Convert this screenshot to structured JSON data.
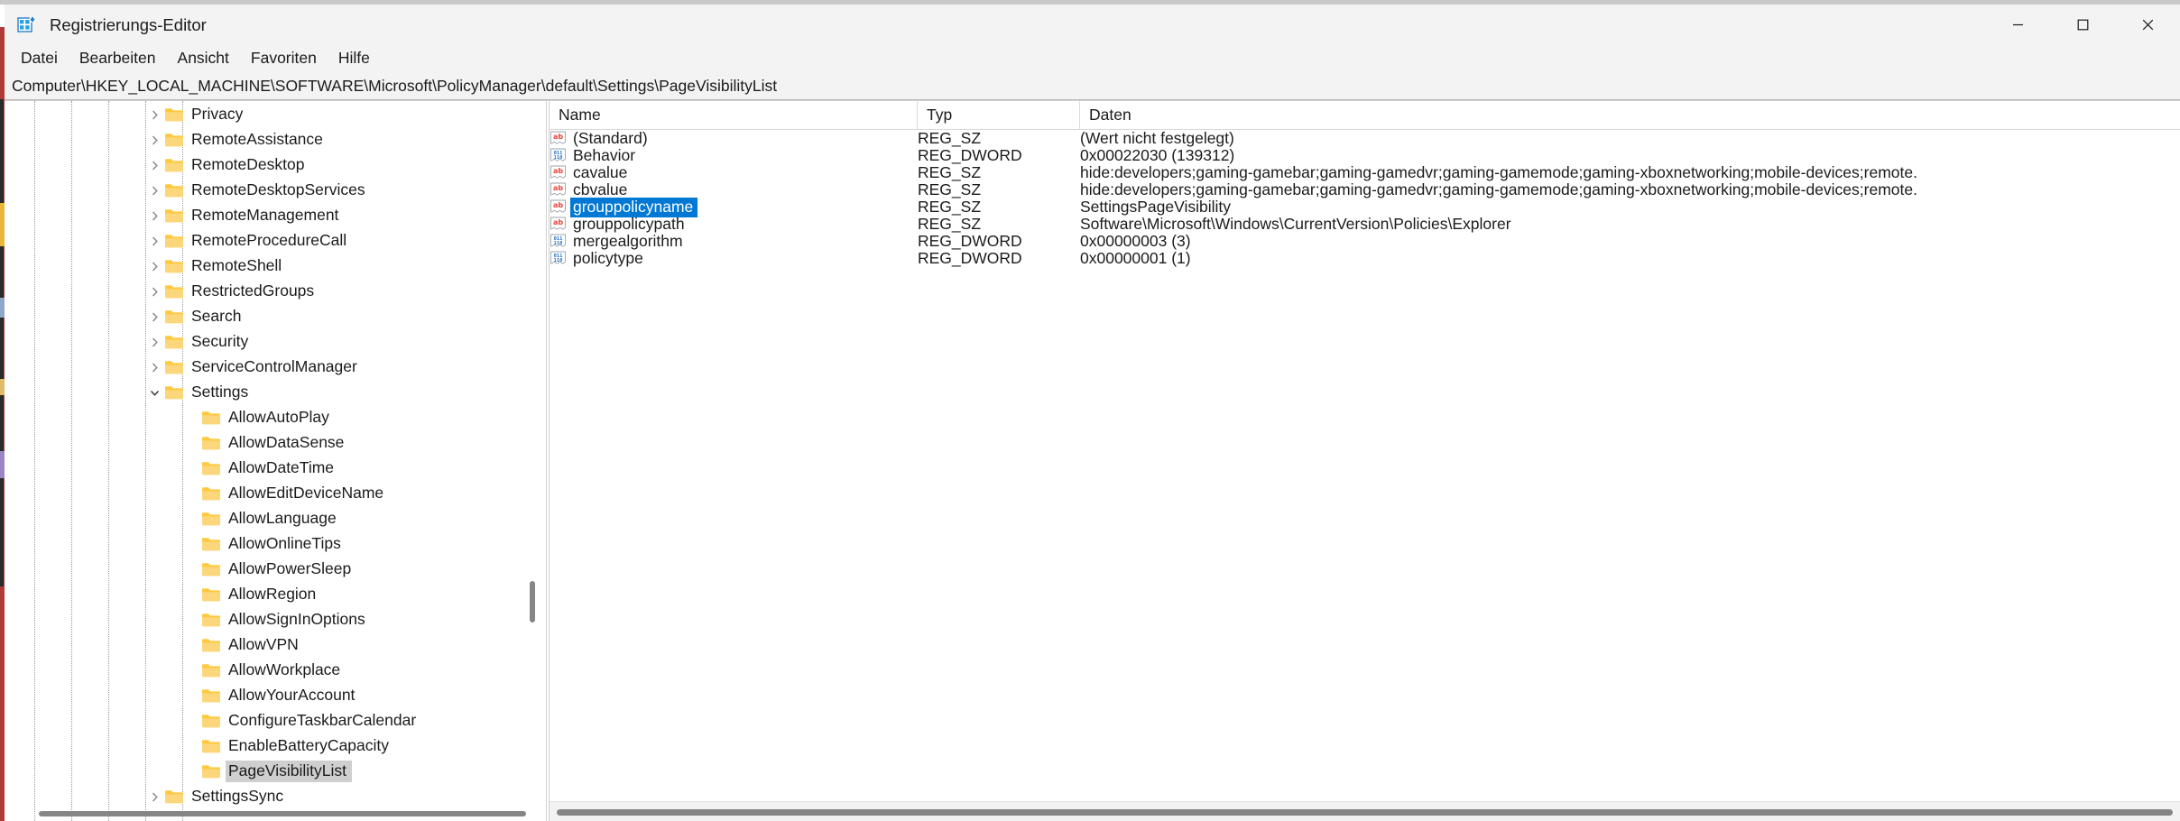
{
  "window": {
    "title": "Registrierungs-Editor",
    "icon": "registry-editor-icon",
    "controls": {
      "minimize": "minimize-icon",
      "maximize": "maximize-icon",
      "close": "close-icon"
    }
  },
  "menubar": {
    "items": [
      {
        "label": "Datei"
      },
      {
        "label": "Bearbeiten"
      },
      {
        "label": "Ansicht"
      },
      {
        "label": "Favoriten"
      },
      {
        "label": "Hilfe"
      }
    ]
  },
  "addressbar": {
    "path": "Computer\\HKEY_LOCAL_MACHINE\\SOFTWARE\\Microsoft\\PolicyManager\\default\\Settings\\PageVisibilityList"
  },
  "tree": {
    "items": [
      {
        "label": "Privacy",
        "depth": 5,
        "expander": "collapsed",
        "selected": false
      },
      {
        "label": "RemoteAssistance",
        "depth": 5,
        "expander": "collapsed",
        "selected": false
      },
      {
        "label": "RemoteDesktop",
        "depth": 5,
        "expander": "collapsed",
        "selected": false
      },
      {
        "label": "RemoteDesktopServices",
        "depth": 5,
        "expander": "collapsed",
        "selected": false
      },
      {
        "label": "RemoteManagement",
        "depth": 5,
        "expander": "collapsed",
        "selected": false
      },
      {
        "label": "RemoteProcedureCall",
        "depth": 5,
        "expander": "collapsed",
        "selected": false
      },
      {
        "label": "RemoteShell",
        "depth": 5,
        "expander": "collapsed",
        "selected": false
      },
      {
        "label": "RestrictedGroups",
        "depth": 5,
        "expander": "collapsed",
        "selected": false
      },
      {
        "label": "Search",
        "depth": 5,
        "expander": "collapsed",
        "selected": false
      },
      {
        "label": "Security",
        "depth": 5,
        "expander": "collapsed",
        "selected": false
      },
      {
        "label": "ServiceControlManager",
        "depth": 5,
        "expander": "collapsed",
        "selected": false
      },
      {
        "label": "Settings",
        "depth": 5,
        "expander": "expanded",
        "selected": false
      },
      {
        "label": "AllowAutoPlay",
        "depth": 6,
        "expander": "none",
        "selected": false
      },
      {
        "label": "AllowDataSense",
        "depth": 6,
        "expander": "none",
        "selected": false
      },
      {
        "label": "AllowDateTime",
        "depth": 6,
        "expander": "none",
        "selected": false
      },
      {
        "label": "AllowEditDeviceName",
        "depth": 6,
        "expander": "none",
        "selected": false
      },
      {
        "label": "AllowLanguage",
        "depth": 6,
        "expander": "none",
        "selected": false
      },
      {
        "label": "AllowOnlineTips",
        "depth": 6,
        "expander": "none",
        "selected": false
      },
      {
        "label": "AllowPowerSleep",
        "depth": 6,
        "expander": "none",
        "selected": false
      },
      {
        "label": "AllowRegion",
        "depth": 6,
        "expander": "none",
        "selected": false
      },
      {
        "label": "AllowSignInOptions",
        "depth": 6,
        "expander": "none",
        "selected": false
      },
      {
        "label": "AllowVPN",
        "depth": 6,
        "expander": "none",
        "selected": false
      },
      {
        "label": "AllowWorkplace",
        "depth": 6,
        "expander": "none",
        "selected": false
      },
      {
        "label": "AllowYourAccount",
        "depth": 6,
        "expander": "none",
        "selected": false
      },
      {
        "label": "ConfigureTaskbarCalendar",
        "depth": 6,
        "expander": "none",
        "selected": false
      },
      {
        "label": "EnableBatteryCapacity",
        "depth": 6,
        "expander": "none",
        "selected": false
      },
      {
        "label": "PageVisibilityList",
        "depth": 6,
        "expander": "none",
        "selected": true
      },
      {
        "label": "SettingsSync",
        "depth": 5,
        "expander": "collapsed",
        "selected": false
      }
    ]
  },
  "list": {
    "columns": [
      {
        "key": "name",
        "label": "Name"
      },
      {
        "key": "typ",
        "label": "Typ"
      },
      {
        "key": "daten",
        "label": "Daten"
      }
    ],
    "rows": [
      {
        "icon": "string-value-icon",
        "name": "(Standard)",
        "typ": "REG_SZ",
        "daten": "(Wert nicht festgelegt)",
        "selected": false
      },
      {
        "icon": "dword-value-icon",
        "name": "Behavior",
        "typ": "REG_DWORD",
        "daten": "0x00022030 (139312)",
        "selected": false
      },
      {
        "icon": "string-value-icon",
        "name": "cavalue",
        "typ": "REG_SZ",
        "daten": "hide:developers;gaming-gamebar;gaming-gamedvr;gaming-gamemode;gaming-xboxnetworking;mobile-devices;remote.",
        "selected": false
      },
      {
        "icon": "string-value-icon",
        "name": "cbvalue",
        "typ": "REG_SZ",
        "daten": "hide:developers;gaming-gamebar;gaming-gamedvr;gaming-gamemode;gaming-xboxnetworking;mobile-devices;remote.",
        "selected": false
      },
      {
        "icon": "string-value-icon",
        "name": "grouppolicyname",
        "typ": "REG_SZ",
        "daten": "SettingsPageVisibility",
        "selected": true
      },
      {
        "icon": "string-value-icon",
        "name": "grouppolicypath",
        "typ": "REG_SZ",
        "daten": "Software\\Microsoft\\Windows\\CurrentVersion\\Policies\\Explorer",
        "selected": false
      },
      {
        "icon": "dword-value-icon",
        "name": "mergealgorithm",
        "typ": "REG_DWORD",
        "daten": "0x00000003 (3)",
        "selected": false
      },
      {
        "icon": "dword-value-icon",
        "name": "policytype",
        "typ": "REG_DWORD",
        "daten": "0x00000001 (1)",
        "selected": false
      }
    ]
  },
  "colors": {
    "selection_focused": "#0078d4",
    "selection_unfocused": "#cfcfcf",
    "chrome": "#f3f3f3",
    "folder_icon": "#ffc83d",
    "string_icon_text": "#e8443a",
    "dword_icon_text": "#1b6ec2"
  },
  "scrollbars": {
    "tree_vertical": "tree-vertical-scrollbar",
    "tree_horizontal": "tree-horizontal-scrollbar",
    "list_horizontal": "list-horizontal-scrollbar"
  }
}
